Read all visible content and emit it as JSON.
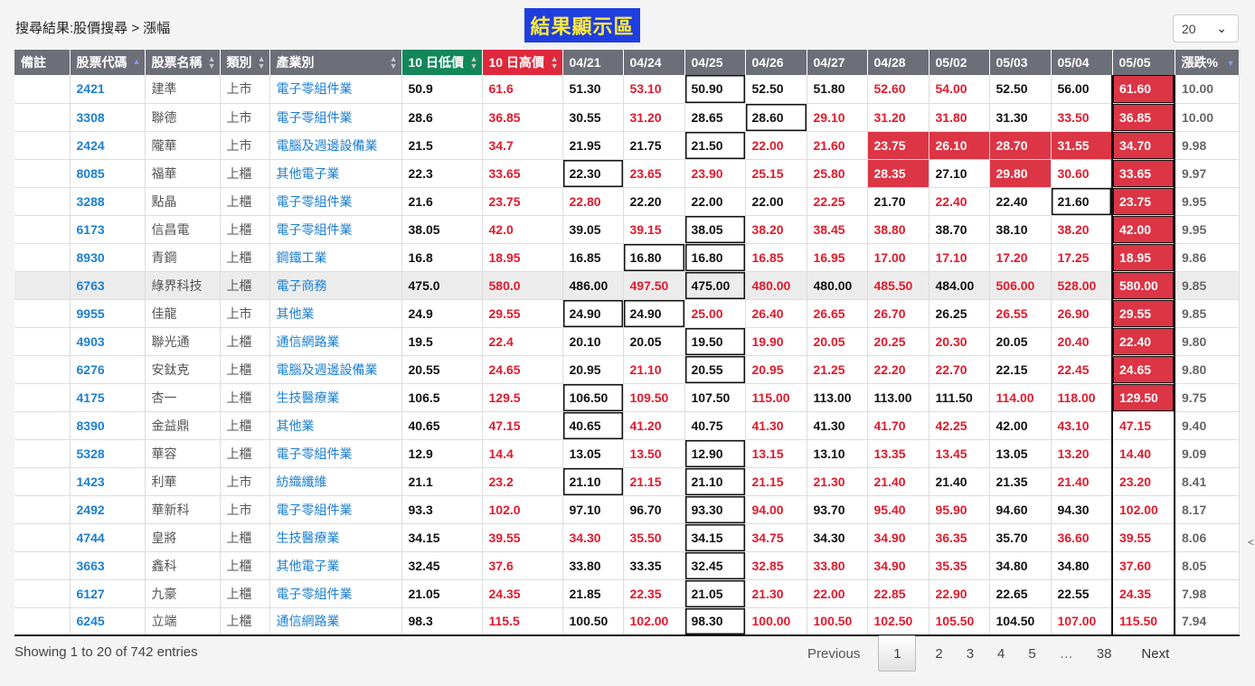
{
  "header": {
    "title": "搜尋結果:股價搜尋 > 漲幅",
    "banner": "結果顯示區",
    "page_length": "20"
  },
  "side_tab": "<",
  "columns": [
    "備註",
    "股票代碼",
    "股票名稱",
    "類別",
    "產業別",
    "10 日低價",
    "10 日高價",
    "04/21",
    "04/24",
    "04/25",
    "04/26",
    "04/27",
    "04/28",
    "05/02",
    "05/03",
    "05/04",
    "05/05",
    "漲跌%"
  ],
  "rows": [
    {
      "code": "2421",
      "name": "建準",
      "mkt": "上市",
      "ind": "電子零組件業",
      "low": "50.9",
      "high": "61.6",
      "p": [
        "51.30",
        "53.10",
        "50.90",
        "52.50",
        "51.80",
        "52.60",
        "54.00",
        "52.50",
        "56.00",
        "61.60"
      ],
      "pct": "10.00"
    },
    {
      "code": "3308",
      "name": "聯德",
      "mkt": "上市",
      "ind": "電子零組件業",
      "low": "28.6",
      "high": "36.85",
      "p": [
        "30.55",
        "31.20",
        "28.65",
        "28.60",
        "29.10",
        "31.20",
        "31.80",
        "31.30",
        "33.50",
        "36.85"
      ],
      "pct": "10.00"
    },
    {
      "code": "2424",
      "name": "隴華",
      "mkt": "上市",
      "ind": "電腦及週邊設備業",
      "low": "21.5",
      "high": "34.7",
      "p": [
        "21.95",
        "21.75",
        "21.50",
        "22.00",
        "21.60",
        "23.75",
        "26.10",
        "28.70",
        "31.55",
        "34.70"
      ],
      "pct": "9.98"
    },
    {
      "code": "8085",
      "name": "福華",
      "mkt": "上櫃",
      "ind": "其他電子業",
      "low": "22.3",
      "high": "33.65",
      "p": [
        "22.30",
        "23.65",
        "23.90",
        "25.15",
        "25.80",
        "28.35",
        "27.10",
        "29.80",
        "30.60",
        "33.65"
      ],
      "pct": "9.97"
    },
    {
      "code": "3288",
      "name": "點晶",
      "mkt": "上櫃",
      "ind": "電子零組件業",
      "low": "21.6",
      "high": "23.75",
      "p": [
        "22.80",
        "22.20",
        "22.00",
        "22.00",
        "22.25",
        "21.70",
        "22.40",
        "22.40",
        "21.60",
        "23.75"
      ],
      "pct": "9.95"
    },
    {
      "code": "6173",
      "name": "信昌電",
      "mkt": "上櫃",
      "ind": "電子零組件業",
      "low": "38.05",
      "high": "42.0",
      "p": [
        "39.05",
        "39.15",
        "38.05",
        "38.20",
        "38.45",
        "38.80",
        "38.70",
        "38.10",
        "38.20",
        "42.00"
      ],
      "pct": "9.95"
    },
    {
      "code": "8930",
      "name": "青鋼",
      "mkt": "上櫃",
      "ind": "鋼鐵工業",
      "low": "16.8",
      "high": "18.95",
      "p": [
        "16.85",
        "16.80",
        "16.80",
        "16.85",
        "16.95",
        "17.00",
        "17.10",
        "17.20",
        "17.25",
        "18.95"
      ],
      "pct": "9.86"
    },
    {
      "code": "6763",
      "name": "綠界科技",
      "mkt": "上櫃",
      "ind": "電子商務",
      "low": "475.0",
      "high": "580.0",
      "p": [
        "486.00",
        "497.50",
        "475.00",
        "480.00",
        "480.00",
        "485.50",
        "484.00",
        "506.00",
        "528.00",
        "580.00"
      ],
      "pct": "9.85"
    },
    {
      "code": "9955",
      "name": "佳龍",
      "mkt": "上市",
      "ind": "其他業",
      "low": "24.9",
      "high": "29.55",
      "p": [
        "24.90",
        "24.90",
        "25.00",
        "26.40",
        "26.65",
        "26.70",
        "26.25",
        "26.55",
        "26.90",
        "29.55"
      ],
      "pct": "9.85"
    },
    {
      "code": "4903",
      "name": "聯光通",
      "mkt": "上櫃",
      "ind": "通信網路業",
      "low": "19.5",
      "high": "22.4",
      "p": [
        "20.10",
        "20.05",
        "19.50",
        "19.90",
        "20.05",
        "20.25",
        "20.30",
        "20.05",
        "20.40",
        "22.40"
      ],
      "pct": "9.80"
    },
    {
      "code": "6276",
      "name": "安鈦克",
      "mkt": "上櫃",
      "ind": "電腦及週邊設備業",
      "low": "20.55",
      "high": "24.65",
      "p": [
        "20.95",
        "21.10",
        "20.55",
        "20.95",
        "21.25",
        "22.20",
        "22.70",
        "22.15",
        "22.45",
        "24.65"
      ],
      "pct": "9.80"
    },
    {
      "code": "4175",
      "name": "杏一",
      "mkt": "上櫃",
      "ind": "生技醫療業",
      "low": "106.5",
      "high": "129.5",
      "p": [
        "106.50",
        "109.50",
        "107.50",
        "115.00",
        "113.00",
        "113.00",
        "111.50",
        "114.00",
        "118.00",
        "129.50"
      ],
      "pct": "9.75"
    },
    {
      "code": "8390",
      "name": "金益鼎",
      "mkt": "上櫃",
      "ind": "其他業",
      "low": "40.65",
      "high": "47.15",
      "p": [
        "40.65",
        "41.20",
        "40.75",
        "41.30",
        "41.30",
        "41.70",
        "42.25",
        "42.00",
        "43.10",
        "47.15"
      ],
      "pct": "9.40"
    },
    {
      "code": "5328",
      "name": "華容",
      "mkt": "上櫃",
      "ind": "電子零組件業",
      "low": "12.9",
      "high": "14.4",
      "p": [
        "13.05",
        "13.50",
        "12.90",
        "13.15",
        "13.10",
        "13.35",
        "13.45",
        "13.05",
        "13.20",
        "14.40"
      ],
      "pct": "9.09"
    },
    {
      "code": "1423",
      "name": "利華",
      "mkt": "上市",
      "ind": "紡織纖維",
      "low": "21.1",
      "high": "23.2",
      "p": [
        "21.10",
        "21.15",
        "21.10",
        "21.15",
        "21.30",
        "21.40",
        "21.40",
        "21.35",
        "21.40",
        "23.20"
      ],
      "pct": "8.41"
    },
    {
      "code": "2492",
      "name": "華新科",
      "mkt": "上市",
      "ind": "電子零組件業",
      "low": "93.3",
      "high": "102.0",
      "p": [
        "97.10",
        "96.70",
        "93.30",
        "94.00",
        "93.70",
        "95.40",
        "95.90",
        "94.60",
        "94.30",
        "102.00"
      ],
      "pct": "8.17"
    },
    {
      "code": "4744",
      "name": "皇將",
      "mkt": "上櫃",
      "ind": "生技醫療業",
      "low": "34.15",
      "high": "39.55",
      "p": [
        "34.30",
        "35.50",
        "34.15",
        "34.75",
        "34.30",
        "34.90",
        "36.35",
        "35.70",
        "36.60",
        "39.55"
      ],
      "pct": "8.06"
    },
    {
      "code": "3663",
      "name": "鑫科",
      "mkt": "上櫃",
      "ind": "其他電子業",
      "low": "32.45",
      "high": "37.6",
      "p": [
        "33.80",
        "33.35",
        "32.45",
        "32.85",
        "33.80",
        "34.90",
        "35.35",
        "34.80",
        "34.80",
        "37.60"
      ],
      "pct": "8.05"
    },
    {
      "code": "6127",
      "name": "九豪",
      "mkt": "上櫃",
      "ind": "電子零組件業",
      "low": "21.05",
      "high": "24.35",
      "p": [
        "21.85",
        "22.35",
        "21.05",
        "21.30",
        "22.00",
        "22.85",
        "22.90",
        "22.65",
        "22.55",
        "24.35"
      ],
      "pct": "7.98"
    },
    {
      "code": "6245",
      "name": "立端",
      "mkt": "上櫃",
      "ind": "通信網路業",
      "low": "98.3",
      "high": "115.5",
      "p": [
        "100.50",
        "102.00",
        "98.30",
        "100.00",
        "100.50",
        "102.50",
        "105.50",
        "104.50",
        "107.00",
        "115.50"
      ],
      "pct": "7.94"
    }
  ],
  "styles": {
    "red": [
      [
        1,
        5,
        6,
        9
      ],
      [
        1,
        4,
        5,
        6,
        8,
        9
      ],
      [
        3,
        4,
        5,
        6,
        7,
        8,
        9
      ],
      [
        1,
        2,
        3,
        4,
        5,
        7,
        8,
        9
      ],
      [
        0,
        4,
        6,
        9
      ],
      [
        1,
        3,
        4,
        5,
        8,
        9
      ],
      [
        3,
        4,
        5,
        6,
        7,
        8,
        9
      ],
      [
        1,
        3,
        5,
        7,
        8,
        9
      ],
      [
        2,
        3,
        4,
        5,
        7,
        8,
        9
      ],
      [
        3,
        4,
        5,
        6,
        8,
        9
      ],
      [
        1,
        3,
        4,
        5,
        6,
        8,
        9
      ],
      [
        1,
        3,
        7,
        8,
        9
      ],
      [
        1,
        3,
        5,
        6,
        8,
        9
      ],
      [
        1,
        3,
        5,
        6,
        8,
        9
      ],
      [
        1,
        3,
        4,
        5,
        8,
        9
      ],
      [
        3,
        5,
        6,
        9
      ],
      [
        0,
        1,
        3,
        5,
        6,
        8,
        9
      ],
      [
        3,
        4,
        5,
        6,
        9
      ],
      [
        1,
        3,
        4,
        5,
        6,
        9
      ],
      [
        1,
        3,
        4,
        5,
        6,
        8,
        9
      ]
    ],
    "box": [
      [
        2
      ],
      [
        3
      ],
      [
        2
      ],
      [
        0
      ],
      [
        8
      ],
      [
        2
      ],
      [
        1,
        2
      ],
      [
        2
      ],
      [
        0,
        1
      ],
      [
        2
      ],
      [
        2
      ],
      [
        0
      ],
      [
        0
      ],
      [
        2
      ],
      [
        0,
        2
      ],
      [
        2
      ],
      [
        2
      ],
      [
        2
      ],
      [
        2
      ],
      [
        2
      ]
    ],
    "fill": [
      [
        9
      ],
      [
        9
      ],
      [
        5,
        6,
        7,
        8,
        9
      ],
      [
        5,
        7,
        9
      ],
      [
        9
      ],
      [
        9
      ],
      [
        9
      ],
      [
        9
      ],
      [
        9
      ],
      [
        9
      ],
      [
        9
      ],
      [
        9
      ],
      [],
      [],
      [],
      [],
      [],
      [],
      [],
      []
    ]
  },
  "footer": {
    "info": "Showing 1 to 20 of 742 entries",
    "previous": "Previous",
    "next": "Next",
    "pages": [
      "1",
      "2",
      "3",
      "4",
      "5",
      "…",
      "38"
    ]
  },
  "colors": {
    "header_gray": "#6c6f78",
    "low_green": "#13875a",
    "high_red": "#e0283c",
    "cell_red": "#dc3545",
    "link_blue": "#1d7fd0",
    "banner_blue": "#1f3ee0",
    "banner_yellow": "#ffeb3b"
  }
}
